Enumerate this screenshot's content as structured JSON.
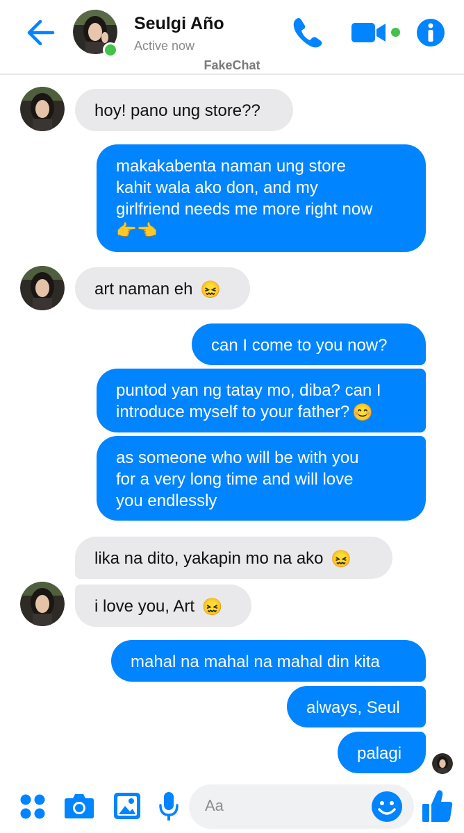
{
  "header": {
    "contact_name": "Seulgi Año",
    "status": "Active now",
    "watermark": "FakeChat",
    "icons": [
      "back-arrow-icon",
      "phone-icon",
      "video-camera-icon",
      "info-icon"
    ]
  },
  "messages": [
    {
      "side": "in",
      "text": "hoy! pano ung store??"
    },
    {
      "side": "out",
      "lines": [
        "makakabenta naman ung store",
        "kahit wala ako don, and my",
        "girlfriend needs me more right now"
      ],
      "emoji": "👉👈"
    },
    {
      "side": "in",
      "text": "art naman eh",
      "emoji": "😖"
    },
    {
      "side": "out",
      "text": "can I come to you now?"
    },
    {
      "side": "out",
      "lines": [
        "puntod yan ng tatay mo, diba? can I",
        "introduce myself to your father?"
      ],
      "emoji": "😊"
    },
    {
      "side": "out",
      "lines": [
        "as someone who will be with you",
        "for a very long time and will love",
        "you endlessly"
      ]
    },
    {
      "side": "in",
      "text": "lika na dito, yakapin mo na ako",
      "emoji": "😖"
    },
    {
      "side": "in",
      "text": "i love you, Art",
      "emoji": "😖"
    },
    {
      "side": "out",
      "text": "mahal na mahal na mahal din kita"
    },
    {
      "side": "out",
      "text": "always, Seul"
    },
    {
      "side": "out",
      "text": "palagi"
    }
  ],
  "composer": {
    "placeholder": "Aa",
    "icons": [
      "apps-grid-icon",
      "camera-icon",
      "image-icon",
      "microphone-icon",
      "emoji-icon",
      "thumbs-up-icon"
    ]
  },
  "colors": {
    "accent": "#0084ff",
    "incoming_bubble": "#e9e9eb",
    "online": "#44c24a"
  }
}
